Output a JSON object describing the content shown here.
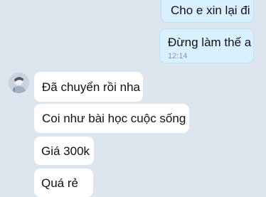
{
  "conversation": {
    "sent": [
      {
        "text": "Cho e xin lại đi",
        "time": ""
      },
      {
        "text": "Đừng làm thế a",
        "time": "12:14"
      }
    ],
    "received": [
      {
        "text": "Đã chuyển rồi nha"
      },
      {
        "text": "Coi như bài học cuộc sống"
      },
      {
        "text": "Giá 300k"
      },
      {
        "text": "Quá rẻ"
      }
    ],
    "contact_avatar_icon": "avatar-icon",
    "colors": {
      "background": "#dde5ee",
      "sent_bubble": "#d9f0ff",
      "received_bubble": "#ffffff",
      "timestamp": "#8a97a4"
    }
  }
}
